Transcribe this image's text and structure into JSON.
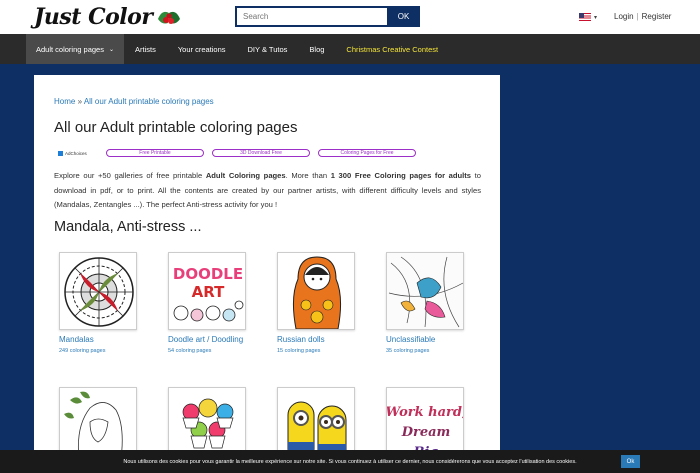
{
  "header": {
    "logo_text": "Just Color",
    "search_placeholder": "Search",
    "search_button": "OK",
    "login": "Login",
    "separator": "|",
    "register": "Register"
  },
  "nav": {
    "items": [
      {
        "label": "Adult coloring pages"
      },
      {
        "label": "Artists"
      },
      {
        "label": "Your creations"
      },
      {
        "label": "DIY & Tutos"
      },
      {
        "label": "Blog"
      },
      {
        "label": "Christmas Creative Contest"
      }
    ]
  },
  "breadcrumb": {
    "home": "Home",
    "separator": "»",
    "current": "All our Adult printable coloring pages"
  },
  "page_title": "All our Adult printable coloring pages",
  "ad": {
    "brand": "AdChoices",
    "pills": [
      "Free Printable",
      "3D Download Free",
      "Coloring Pages for Free"
    ]
  },
  "intro": {
    "p1": "Explore our +50 galleries of free printable ",
    "b1": "Adult Coloring pages",
    "p2": ". More than ",
    "b2": "1 300 Free Coloring pages for adults",
    "p3": " to download in pdf, or to print. All the contents are created by our partner artists, with different difficulty levels and styles (Mandalas, Zentangles ...). The perfect Anti-stress activity for you !"
  },
  "section_title": "Mandala, Anti-stress ...",
  "cards": [
    {
      "title": "Mandalas",
      "count": "249 coloring pages",
      "thumb": "mandala"
    },
    {
      "title": "Doodle art / Doodling",
      "count": "54 coloring pages",
      "thumb": "doodle"
    },
    {
      "title": "Russian dolls",
      "count": "15 coloring pages",
      "thumb": "doll"
    },
    {
      "title": "Unclassifiable",
      "count": "35 coloring pages",
      "thumb": "unclassifiable"
    },
    {
      "title": "",
      "count": "",
      "thumb": "woman"
    },
    {
      "title": "",
      "count": "",
      "thumb": "cupcakes"
    },
    {
      "title": "",
      "count": "",
      "thumb": "minions"
    },
    {
      "title": "",
      "count": "",
      "thumb": "lettering"
    }
  ],
  "doodle_letters": "DOODLE ART",
  "lettering_words": "Work hard, Dream Big",
  "cookie": {
    "text": "Nous utilisons des cookies pour vous garantir la meilleure expérience sur notre site. Si vous continuez à utiliser ce dernier, nous considérerons que vous acceptez l'utilisation des cookies.",
    "button": "Ok"
  }
}
